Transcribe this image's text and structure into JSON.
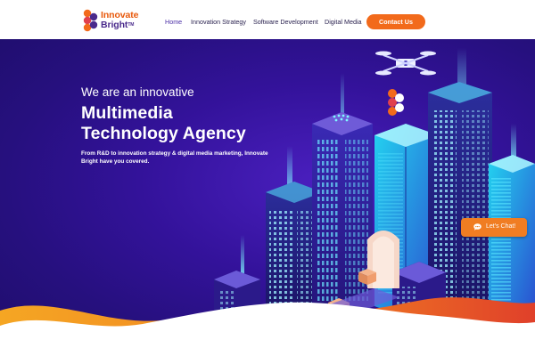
{
  "brand": {
    "line1": "Innovate",
    "line2": "Bright",
    "trademark": "TM",
    "orange": "#f26a1b",
    "purple": "#4a2a8c"
  },
  "nav": {
    "items": [
      {
        "label": "Home",
        "active": true
      },
      {
        "label": "Innovation Strategy",
        "active": false
      },
      {
        "label": "Software Development",
        "active": false
      },
      {
        "label": "Digital Media",
        "active": false
      }
    ],
    "cta_label": "Contact Us"
  },
  "hero": {
    "kicker": "We are an innovative",
    "title_line1": "Multimedia",
    "title_line2": "Technology Agency",
    "description": "From R&D to innovation strategy & digital media marketing, Innovate Bright have you covered.",
    "background": "#33129a"
  },
  "chat": {
    "label": "Let's Chat!",
    "icon": "chat-bubble-icon",
    "color": "#f07d22"
  }
}
